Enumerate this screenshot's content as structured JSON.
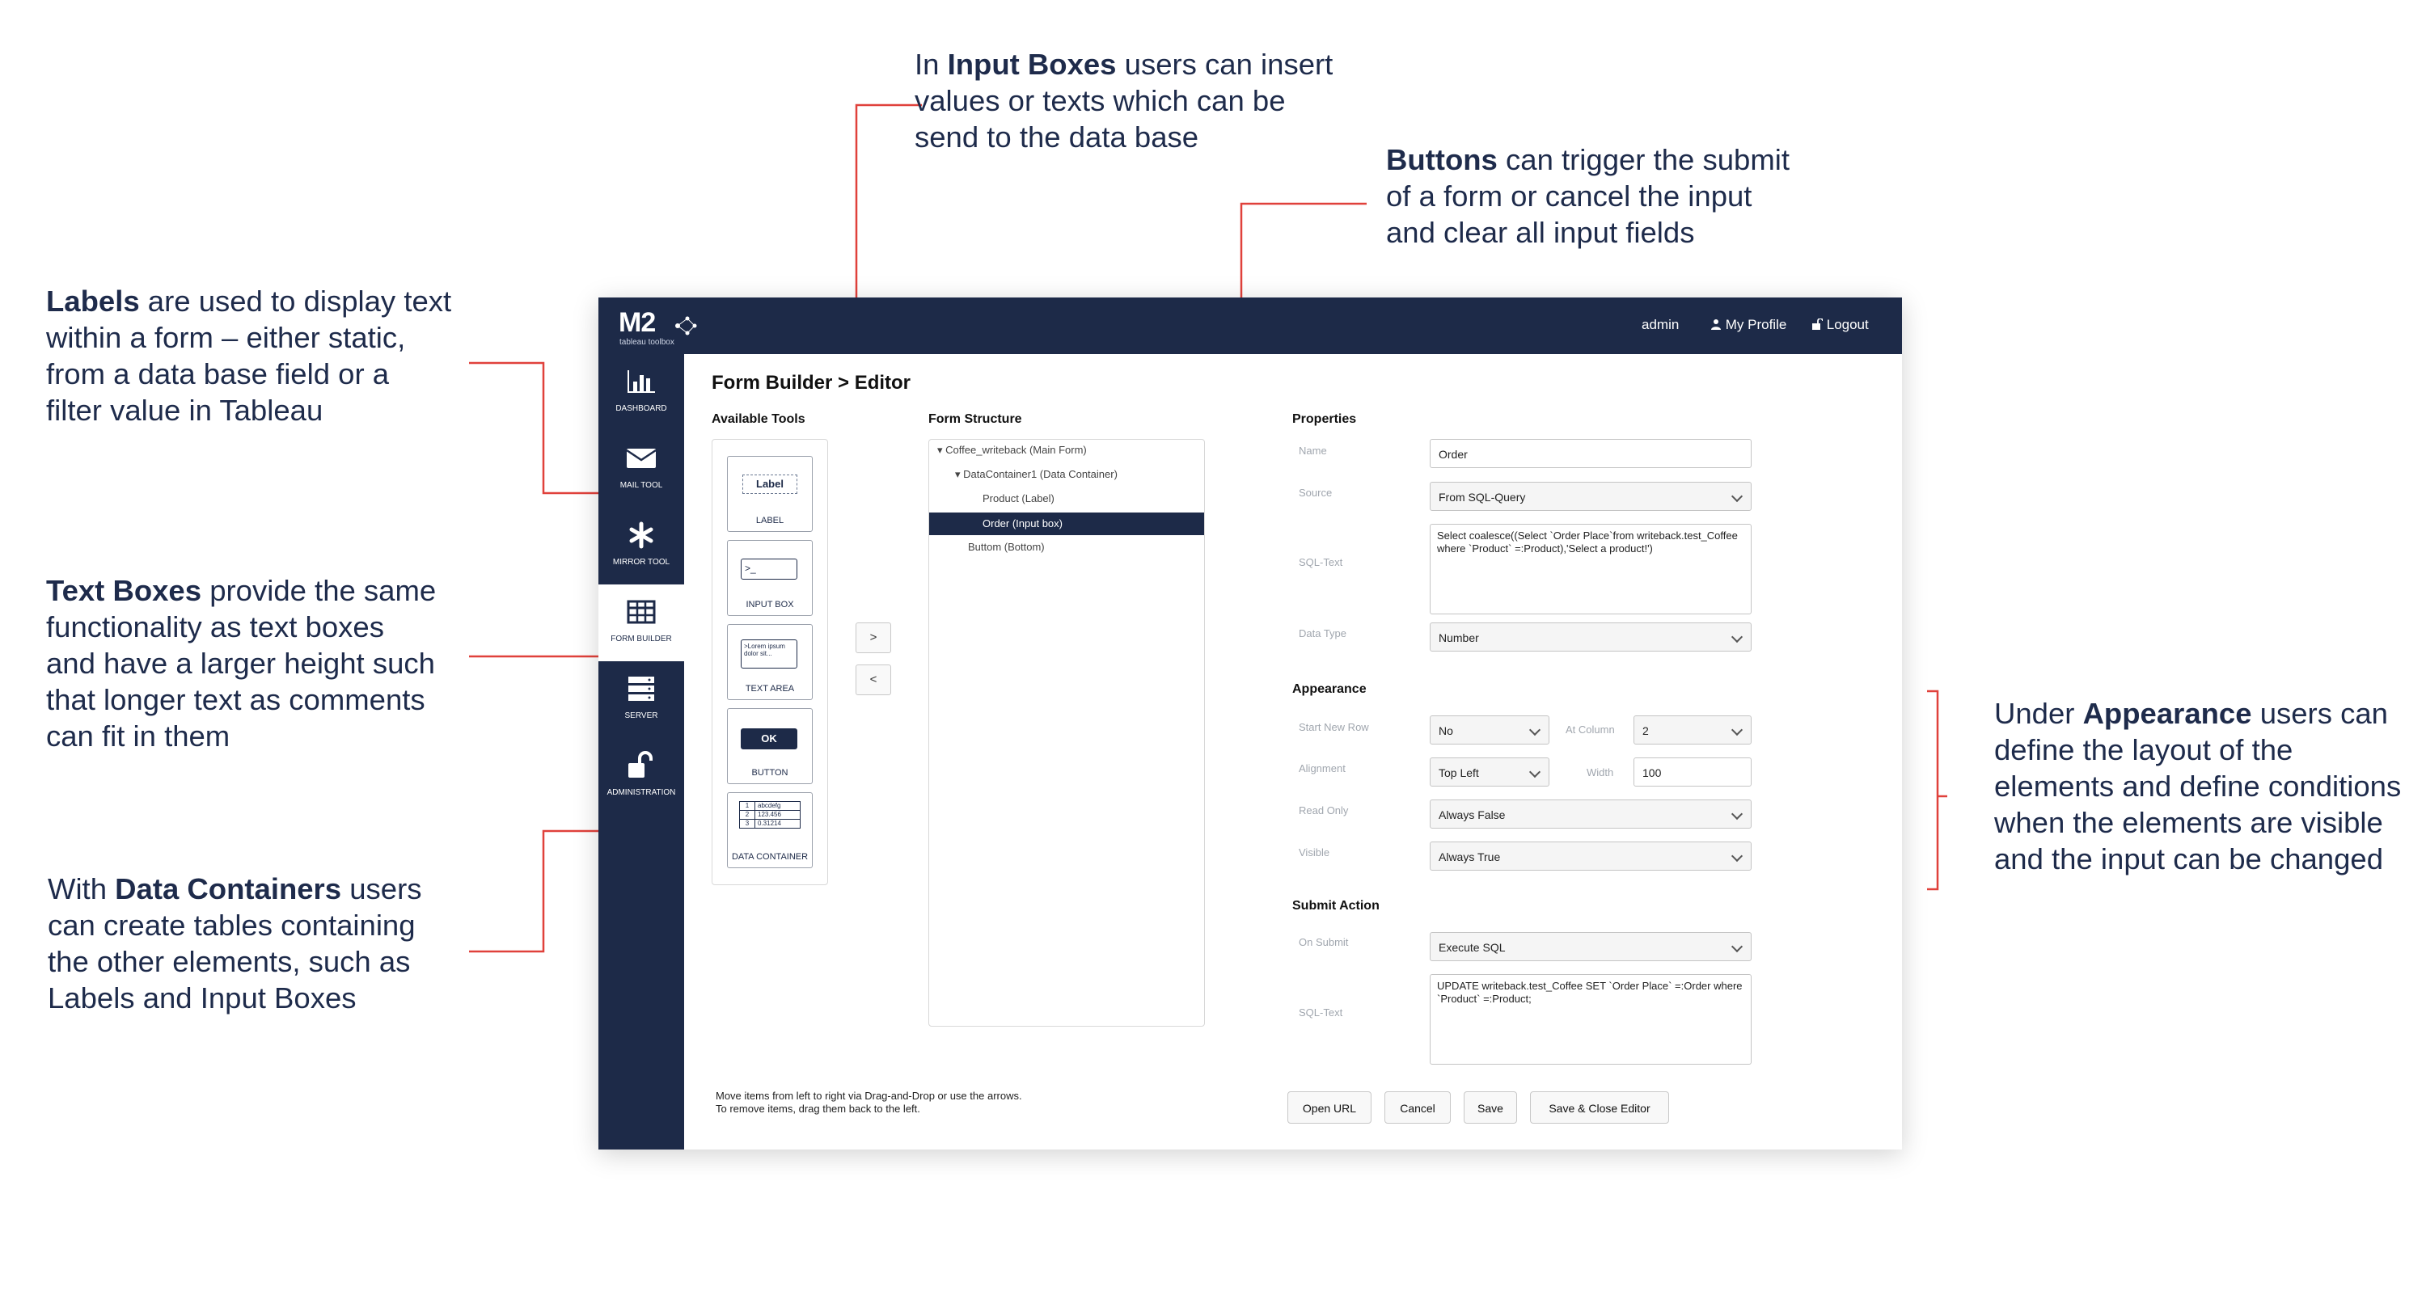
{
  "callouts": {
    "labels": {
      "bold": "Labels",
      "lines": [
        "are used to display text",
        "within a form – either static,",
        "from a data base field or a",
        "filter value in Tableau"
      ]
    },
    "input_boxes": {
      "pre": "In",
      "bold": "Input Boxes",
      "lines": [
        "users can insert",
        "values or texts which can be",
        "send to the data base"
      ]
    },
    "buttons": {
      "bold": "Buttons",
      "lines": [
        "can trigger the submit",
        "of a form or cancel the input",
        "and clear all input fields"
      ]
    },
    "text_boxes": {
      "bold": "Text Boxes",
      "lines": [
        "provide the same",
        "functionality as text boxes",
        "and have a larger height such",
        "that longer text as comments",
        "can fit in them"
      ]
    },
    "data_containers": {
      "pre": "With",
      "bold": "Data Containers",
      "lines": [
        "users",
        "can create tables containing",
        "the other elements, such as",
        "Labels and Input Boxes"
      ]
    },
    "appearance": {
      "pre": "Under",
      "bold": "Appearance",
      "lines": [
        "users can",
        "define the layout of the",
        "elements and define conditions",
        "when the elements are visible",
        "and the input can be changed"
      ]
    }
  },
  "header": {
    "logo": "M2",
    "logo_sub": "tableau toolbox",
    "user": "admin",
    "profile": "My Profile",
    "logout": "Logout"
  },
  "sidebar": {
    "items": [
      {
        "label": "DASHBOARD",
        "icon": "bar-chart-icon"
      },
      {
        "label": "MAIL TOOL",
        "icon": "envelope-icon"
      },
      {
        "label": "MIRROR TOOL",
        "icon": "asterisk-icon"
      },
      {
        "label": "FORM BUILDER",
        "icon": "table-icon"
      },
      {
        "label": "SERVER",
        "icon": "server-icon"
      },
      {
        "label": "ADMINISTRATION",
        "icon": "unlock-icon"
      }
    ]
  },
  "page": {
    "title": "Form Builder > Editor",
    "available_tools": "Available Tools",
    "form_structure": "Form Structure",
    "properties": "Properties",
    "appearance": "Appearance",
    "submit_action": "Submit Action",
    "hint_line1": "Move items from left to right via Drag-and-Drop or use the arrows.",
    "hint_line2": "To remove items, drag them back to the left."
  },
  "tools": [
    {
      "name": "LABEL",
      "preview": "Label"
    },
    {
      "name": "INPUT BOX",
      "preview": ">_"
    },
    {
      "name": "TEXT AREA",
      "preview": ">Lorem ipsum dolor sit..."
    },
    {
      "name": "BUTTON",
      "preview": "OK"
    },
    {
      "name": "DATA CONTAINER",
      "preview_rows": [
        [
          "1",
          "abcdefg"
        ],
        [
          "2",
          "123.456"
        ],
        [
          "3",
          "0.31214"
        ]
      ]
    }
  ],
  "tree": [
    {
      "text": "Coffee_writeback (Main Form)"
    },
    {
      "text": "DataContainer1 (Data Container)"
    },
    {
      "text": "Product (Label)"
    },
    {
      "text": "Order (Input box)"
    },
    {
      "text": "Buttom (Bottom)"
    }
  ],
  "arrows": {
    "right": ">",
    "left": "<"
  },
  "properties": {
    "name_label": "Name",
    "name_value": "Order",
    "source_label": "Source",
    "source_value": "From SQL-Query",
    "sql_label": "SQL-Text",
    "sql_value": "Select coalesce((Select `Order Place`from writeback.test_Coffee where `Product` =:Product),'Select a product!')",
    "type_label": "Data Type",
    "type_value": "Number"
  },
  "appearance": {
    "start_row_label": "Start New Row",
    "start_row_value": "No",
    "at_column_label": "At Column",
    "at_column_value": "2",
    "alignment_label": "Alignment",
    "alignment_value": "Top Left",
    "width_label": "Width",
    "width_value": "100",
    "read_only_label": "Read Only",
    "read_only_value": "Always False",
    "visible_label": "Visible",
    "visible_value": "Always True"
  },
  "submit": {
    "on_submit_label": "On Submit",
    "on_submit_value": "Execute SQL",
    "sql_label": "SQL-Text",
    "sql_value": "UPDATE writeback.test_Coffee SET `Order Place` =:Order where `Product` =:Product;"
  },
  "buttons": {
    "open_url": "Open URL",
    "cancel": "Cancel",
    "save": "Save",
    "save_close": "Save & Close Editor"
  },
  "colors": {
    "navy": "#1d2a48",
    "leader": "#e0413b",
    "callout_text": "#1e2b4b"
  }
}
